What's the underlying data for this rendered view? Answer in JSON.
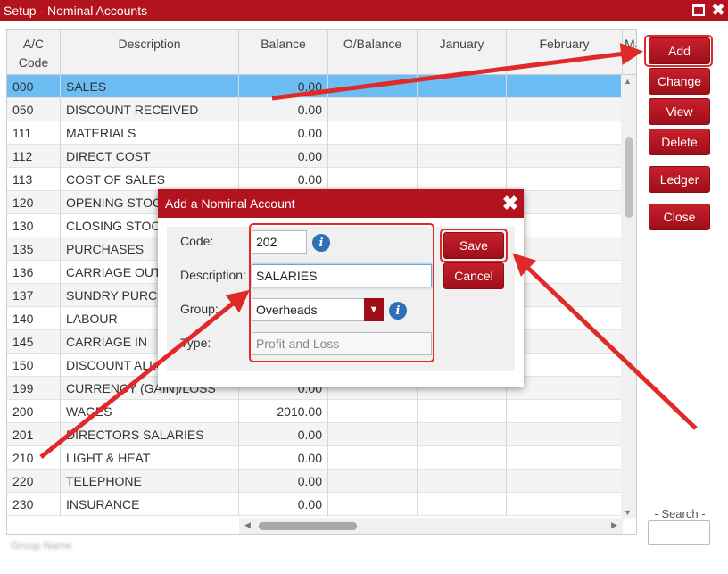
{
  "window": {
    "title": "Setup - Nominal Accounts"
  },
  "columns": {
    "code": "A/C\nCode",
    "description": "Description",
    "balance": "Balance",
    "obalance": "O/Balance",
    "january": "January",
    "february": "February",
    "more": "Ma"
  },
  "rows": [
    {
      "code": "000",
      "description": "SALES",
      "balance": "0.00"
    },
    {
      "code": "050",
      "description": "DISCOUNT RECEIVED",
      "balance": "0.00"
    },
    {
      "code": "111",
      "description": "MATERIALS",
      "balance": "0.00"
    },
    {
      "code": "112",
      "description": "DIRECT COST",
      "balance": "0.00"
    },
    {
      "code": "113",
      "description": "COST OF SALES",
      "balance": "0.00"
    },
    {
      "code": "120",
      "description": "OPENING STOCK",
      "balance": ""
    },
    {
      "code": "130",
      "description": "CLOSING STOCK",
      "balance": ""
    },
    {
      "code": "135",
      "description": "PURCHASES",
      "balance": ""
    },
    {
      "code": "136",
      "description": "CARRIAGE OUT",
      "balance": ""
    },
    {
      "code": "137",
      "description": "SUNDRY PURCH",
      "balance": ""
    },
    {
      "code": "140",
      "description": "LABOUR",
      "balance": ""
    },
    {
      "code": "145",
      "description": "CARRIAGE IN",
      "balance": ""
    },
    {
      "code": "150",
      "description": "DISCOUNT ALLO",
      "balance": ""
    },
    {
      "code": "199",
      "description": "CURRENCY (GAIN)/LOSS",
      "balance": "0.00"
    },
    {
      "code": "200",
      "description": "WAGES",
      "balance": "2010.00"
    },
    {
      "code": "201",
      "description": "DIRECTORS SALARIES",
      "balance": "0.00"
    },
    {
      "code": "210",
      "description": "LIGHT & HEAT",
      "balance": "0.00"
    },
    {
      "code": "220",
      "description": "TELEPHONE",
      "balance": "0.00"
    },
    {
      "code": "230",
      "description": "INSURANCE",
      "balance": "0.00"
    }
  ],
  "side_buttons": {
    "add": "Add",
    "change": "Change",
    "view": "View",
    "delete": "Delete",
    "ledger": "Ledger",
    "close": "Close"
  },
  "search": {
    "label": "- Search -"
  },
  "status": {
    "text": "Group Name"
  },
  "modal": {
    "title": "Add a Nominal Account",
    "code_label": "Code:",
    "code_value": "202",
    "description_label": "Description:",
    "description_value": "SALARIES",
    "group_label": "Group:",
    "group_value": "Overheads",
    "type_label": "Type:",
    "type_value": "Profit and Loss",
    "save": "Save",
    "cancel": "Cancel"
  },
  "colors": {
    "brand_red": "#b3121f",
    "selected_row": "#6bbdf4",
    "annotation": "#e02a2a",
    "info_blue": "#2f6fb4"
  }
}
